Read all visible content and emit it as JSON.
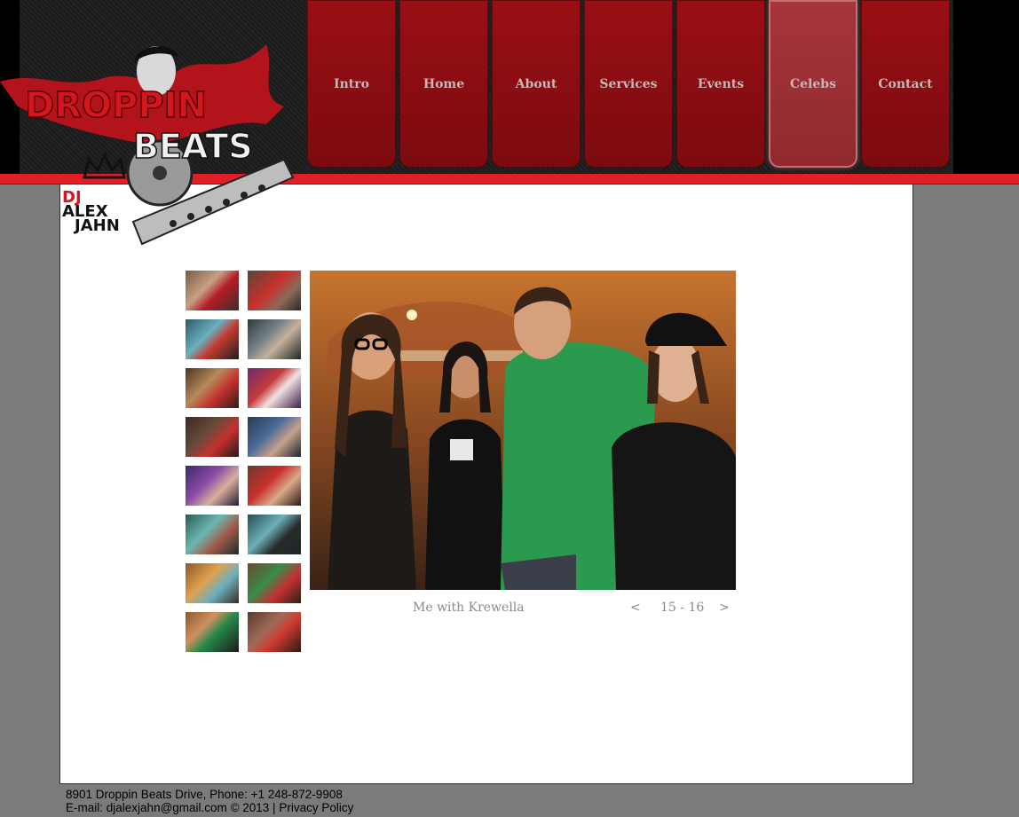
{
  "nav": {
    "items": [
      {
        "label": "Intro",
        "name": "nav-intro"
      },
      {
        "label": "Home",
        "name": "nav-home"
      },
      {
        "label": "About",
        "name": "nav-about"
      },
      {
        "label": "Services",
        "name": "nav-services"
      },
      {
        "label": "Events",
        "name": "nav-events"
      },
      {
        "label": "Celebs",
        "name": "nav-celebs",
        "active": true
      },
      {
        "label": "Contact",
        "name": "nav-contact"
      }
    ]
  },
  "logo": {
    "line1": "DROPPIN",
    "line2": "BEATS",
    "line3": "DJ",
    "line4": "ALEX",
    "line5": "JAHN"
  },
  "gallery": {
    "caption": "Me with Krewella",
    "prev_label": "<",
    "next_label": ">",
    "counter": "15 - 16",
    "thumb_count": 16
  },
  "footer": {
    "address_line": "8901 Droppin Beats Drive, Phone: +1 248-872-9908",
    "email_prefix": "E-mail:",
    "email": "djalexjahn@gmail.com",
    "copyright": "© 2013 |",
    "privacy": "Privacy Policy"
  },
  "colors": {
    "accent_red": "#e21e27",
    "nav_red": "#8a0d12",
    "page_gray": "#7b7b7b"
  }
}
